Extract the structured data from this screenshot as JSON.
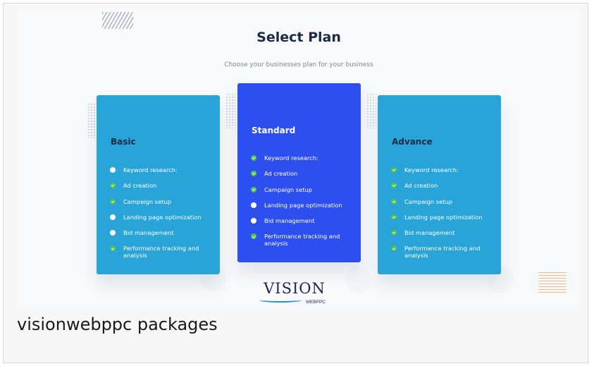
{
  "hero": {
    "title": "Select Plan",
    "subtitle": "Choose your businesses plan for your business"
  },
  "plans": [
    {
      "name": "Basic",
      "color": "#28a4d8",
      "features": [
        {
          "label": "Keyword research:",
          "icon": "dot-icon"
        },
        {
          "label": "Ad creation",
          "icon": "check-icon"
        },
        {
          "label": "Campaign setup",
          "icon": "check-icon"
        },
        {
          "label": "Landing page optimization",
          "icon": "dot-icon"
        },
        {
          "label": "Bid management",
          "icon": "dot-icon"
        },
        {
          "label": "Performance tracking and analysis",
          "icon": "check-icon"
        }
      ]
    },
    {
      "name": "Standard",
      "color": "#2d4ff0",
      "features": [
        {
          "label": "Keyword research:",
          "icon": "check-icon"
        },
        {
          "label": "Ad creation",
          "icon": "check-icon"
        },
        {
          "label": "Campaign setup",
          "icon": "check-icon"
        },
        {
          "label": "Landing page optimization",
          "icon": "dot-icon"
        },
        {
          "label": "Bid management",
          "icon": "dot-icon"
        },
        {
          "label": "Performance tracking and analysis",
          "icon": "check-icon"
        }
      ]
    },
    {
      "name": "Advance",
      "color": "#28a4d8",
      "features": [
        {
          "label": "Keyword research:",
          "icon": "check-icon"
        },
        {
          "label": "Ad creation",
          "icon": "check-icon"
        },
        {
          "label": "Campaign setup",
          "icon": "check-icon"
        },
        {
          "label": "Landing page optimization",
          "icon": "check-icon"
        },
        {
          "label": "Bid management",
          "icon": "check-icon"
        },
        {
          "label": "Performance tracking and analysis",
          "icon": "check-icon"
        }
      ]
    }
  ],
  "logo": {
    "word": "VISION",
    "sub": "WEBPPC"
  },
  "caption": "visionwebppc packages",
  "colors": {
    "check": "#4dc24c",
    "title": "#1f2a44"
  }
}
